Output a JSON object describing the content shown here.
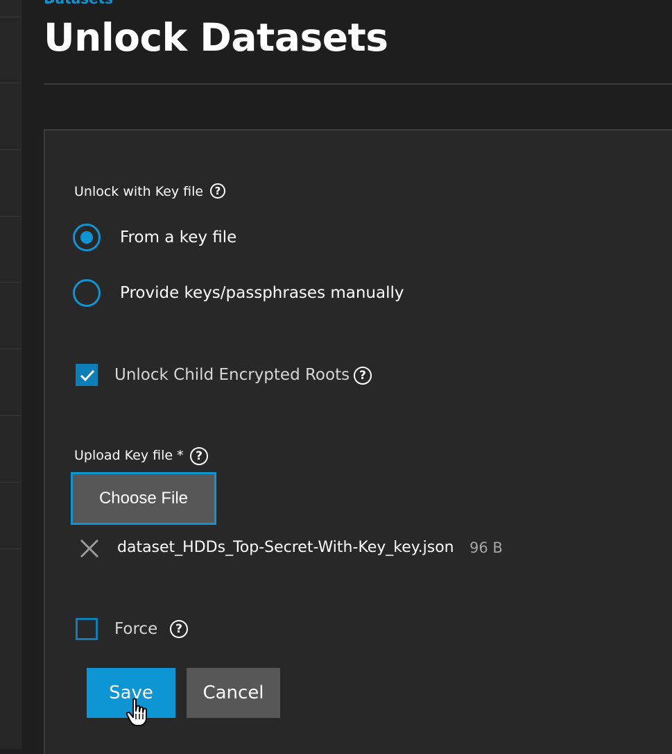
{
  "breadcrumb": "Datasets",
  "page_title": "Unlock Datasets",
  "form": {
    "unlock_with_key_file_label": "Unlock with Key file",
    "radio_options": [
      {
        "label": "From a key file",
        "selected": true
      },
      {
        "label": "Provide keys/passphrases manually",
        "selected": false
      }
    ],
    "unlock_child_label": "Unlock Child Encrypted Roots",
    "unlock_child_checked": true,
    "upload_key_label": "Upload Key file *",
    "choose_file_label": "Choose File",
    "file": {
      "name": "dataset_HDDs_Top-Secret-With-Key_key.json",
      "size": "96 B"
    },
    "force_label": "Force",
    "force_checked": false,
    "save_label": "Save",
    "cancel_label": "Cancel",
    "help_glyph": "?"
  },
  "icons": {
    "help": "help-circle-icon",
    "remove": "close-icon",
    "check": "check-icon",
    "cursor": "hand-pointer-icon"
  },
  "colors": {
    "accent": "#0d95d4",
    "background": "#1e1e1e",
    "card": "#282828",
    "button_secondary": "#575757"
  }
}
